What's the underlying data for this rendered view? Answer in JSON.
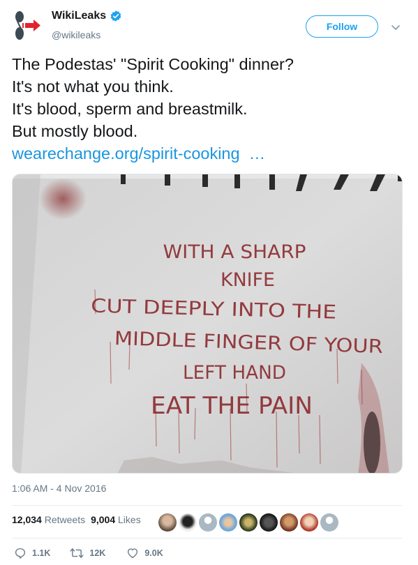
{
  "user": {
    "display_name": "WikiLeaks",
    "handle": "@wikileaks",
    "verified_icon": "verified-badge-icon"
  },
  "follow_label": "Follow",
  "tweet": {
    "lines": [
      "The Podestas' \"Spirit Cooking\" dinner?",
      "It's not what you think.",
      "It's blood, sperm and breastmilk.",
      "But mostly blood."
    ],
    "link": "wearechange.org/spirit-cooking",
    "link_ellipsis": "  …"
  },
  "media": {
    "wall_text": [
      "WITH A SHARP",
      "KNIFE",
      "CUT DEEPLY INTO THE",
      "MIDDLE FINGER OF YOUR",
      "LEFT HAND",
      "EAT THE PAIN"
    ]
  },
  "timestamp": "1:06 AM - 4 Nov 2016",
  "stats": {
    "retweets_count": "12,034",
    "retweets_label": "Retweets",
    "likes_count": "9,004",
    "likes_label": "Likes"
  },
  "actions": {
    "reply_count": "1.1K",
    "retweet_count": "12K",
    "like_count": "9.0K"
  },
  "colors": {
    "brand_blue": "#1da1f2",
    "link_blue": "#1b95e0",
    "muted": "#657786",
    "paint_red": "#9a2f33"
  }
}
